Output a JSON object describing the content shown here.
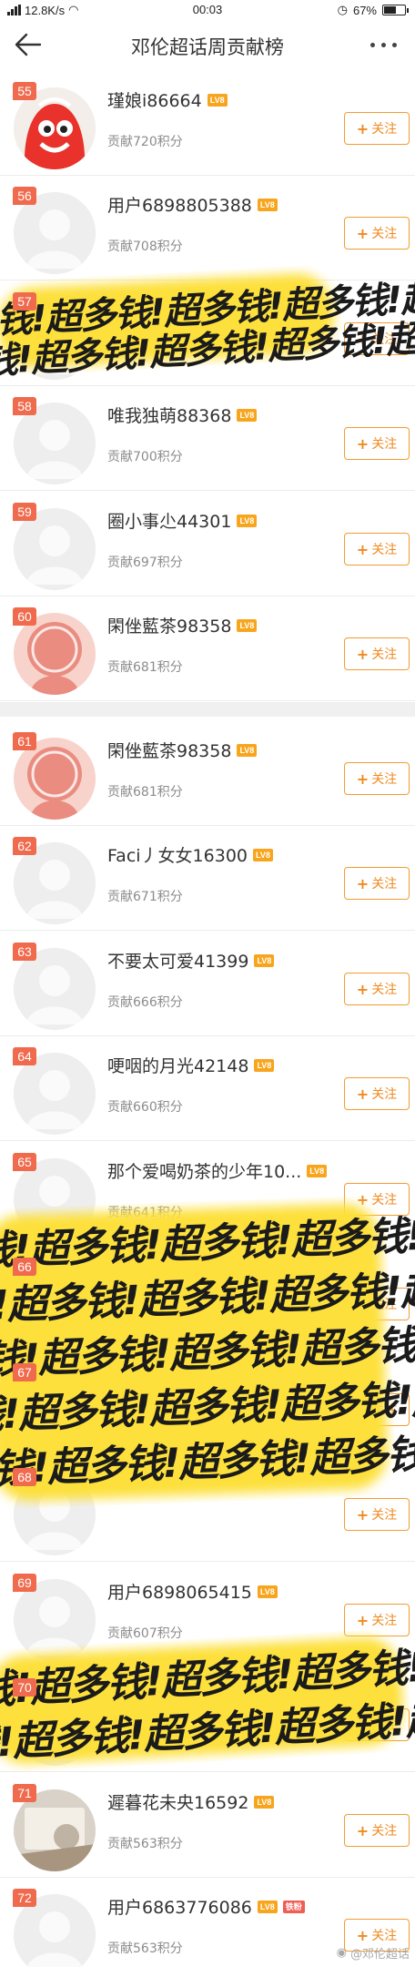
{
  "status_bar": {
    "network_speed": "12.8K/s",
    "time": "00:03",
    "battery": "67%",
    "battery_level": 0.67
  },
  "header": {
    "title": "邓伦超话周贡献榜",
    "back_icon": "back-arrow-icon",
    "more_icon": "more-dots-icon"
  },
  "follow_label": "关注",
  "follow_plus": "+",
  "sticker_text": "钱!超多钱!超多钱!超多钱!超多钱!超多",
  "watermark": "@邓伦超话",
  "colors": {
    "rank_badge": "#f06a4d",
    "level_badge": "#f8a51c",
    "follow_border": "#f39b30",
    "sticker_yellow": "#fde03a"
  },
  "rows": [
    {
      "rank": "55",
      "name": "瑾娘i86664",
      "level": "LV8",
      "score": "贡献720积分",
      "avatar": "cartoon-red-avatar"
    },
    {
      "rank": "56",
      "name": "用户6898805388",
      "level": "LV8",
      "score": "贡献708积分",
      "avatar": "default-avatar"
    },
    {
      "rank": "57",
      "name": "",
      "level": "",
      "score": "",
      "avatar": "default-avatar",
      "covered": true
    },
    {
      "rank": "58",
      "name": "唯我独萌88368",
      "level": "LV8",
      "score": "贡献700积分",
      "avatar": "default-avatar"
    },
    {
      "rank": "59",
      "name": "圈小事尐44301",
      "level": "LV8",
      "score": "贡献697积分",
      "avatar": "default-avatar"
    },
    {
      "rank": "60",
      "name": "閑侳藍茶98358",
      "level": "LV8",
      "score": "贡献681积分",
      "avatar": "pink-avatar"
    },
    {
      "rank": "61",
      "name": "閑侳藍茶98358",
      "level": "LV8",
      "score": "贡献681积分",
      "avatar": "pink-avatar"
    },
    {
      "rank": "62",
      "name": "Faci丿女女16300",
      "level": "LV8",
      "score": "贡献671积分",
      "avatar": "default-avatar"
    },
    {
      "rank": "63",
      "name": "不要太可爱41399",
      "level": "LV8",
      "score": "贡献666积分",
      "avatar": "default-avatar"
    },
    {
      "rank": "64",
      "name": "哽咽的月光42148",
      "level": "LV8",
      "score": "贡献660积分",
      "avatar": "default-avatar"
    },
    {
      "rank": "65",
      "name": "那个爱喝奶茶的少年10...",
      "level": "LV8",
      "score": "贡献641积分",
      "avatar": "default-avatar"
    },
    {
      "rank": "66",
      "name": "",
      "level": "",
      "score": "",
      "avatar": "default-avatar",
      "covered": true
    },
    {
      "rank": "67",
      "name": "",
      "level": "",
      "score": "",
      "avatar": "default-avatar",
      "covered": true
    },
    {
      "rank": "68",
      "name": "",
      "level": "",
      "score": "",
      "avatar": "default-avatar",
      "covered": true
    },
    {
      "rank": "69",
      "name": "用户6898065415",
      "level": "LV8",
      "score": "贡献607积分",
      "avatar": "default-avatar"
    },
    {
      "rank": "70",
      "name": "",
      "level": "",
      "score": "",
      "avatar": "default-avatar",
      "covered": true
    },
    {
      "rank": "71",
      "name": "遲暮花未央16592",
      "level": "LV8",
      "score": "贡献563积分",
      "avatar": "photo-avatar"
    },
    {
      "rank": "72",
      "name": "用户6863776086",
      "level": "LV8",
      "score": "贡献563积分",
      "avatar": "default-avatar",
      "extra_badge": "铁粉"
    }
  ]
}
